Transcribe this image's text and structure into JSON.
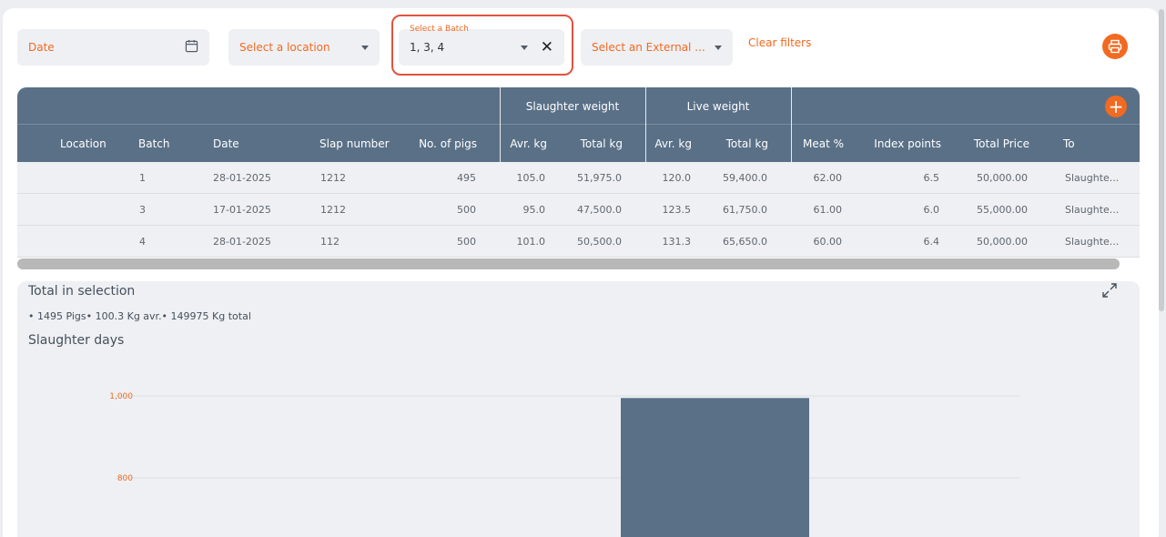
{
  "filters": {
    "date_placeholder": "Date",
    "location_placeholder": "Select a location",
    "batch_label": "Select a Batch",
    "batch_value": "1, 3, 4",
    "external_placeholder": "Select an External ...",
    "clear_label": "Clear filters"
  },
  "icons": {
    "date": "calendar-icon",
    "print": "printer-icon",
    "add": "plus-icon",
    "expand": "expand-icon",
    "clear_batch": "close-icon"
  },
  "colors": {
    "accent": "#f26a21",
    "header": "#5a7087",
    "highlight": "#e0523f"
  },
  "table": {
    "groups": {
      "slaughter": "Slaughter weight",
      "live": "Live weight"
    },
    "columns": [
      "Location",
      "Batch",
      "Date",
      "Slap number",
      "No. of pigs",
      "Avr. kg",
      "Total kg",
      "Avr. kg",
      "Total kg",
      "Meat %",
      "Index points",
      "Total Price",
      "To"
    ],
    "rows": [
      [
        "",
        "1",
        "28-01-2025",
        "1212",
        "495",
        "105.0",
        "51,975.0",
        "120.0",
        "59,400.0",
        "62.00",
        "6.5",
        "50,000.00",
        "Slaughte..."
      ],
      [
        "",
        "3",
        "17-01-2025",
        "1212",
        "500",
        "95.0",
        "47,500.0",
        "123.5",
        "61,750.0",
        "61.00",
        "6.0",
        "55,000.00",
        "Slaughte..."
      ],
      [
        "",
        "4",
        "28-01-2025",
        "112",
        "500",
        "101.0",
        "50,500.0",
        "131.3",
        "65,650.0",
        "60.00",
        "6.4",
        "50,000.00",
        "Slaughte..."
      ]
    ]
  },
  "summary": {
    "title": "Total in selection",
    "line": "• 1495 Pigs• 100.3 Kg avr.• 149975 Kg total",
    "chart_title": "Slaughter days"
  },
  "chart_data": {
    "type": "bar",
    "title": "Slaughter days",
    "y_ticks": [
      "1,000",
      "800"
    ],
    "values": [
      995
    ],
    "ylim": [
      0,
      1000
    ],
    "color": "#5a7087"
  }
}
